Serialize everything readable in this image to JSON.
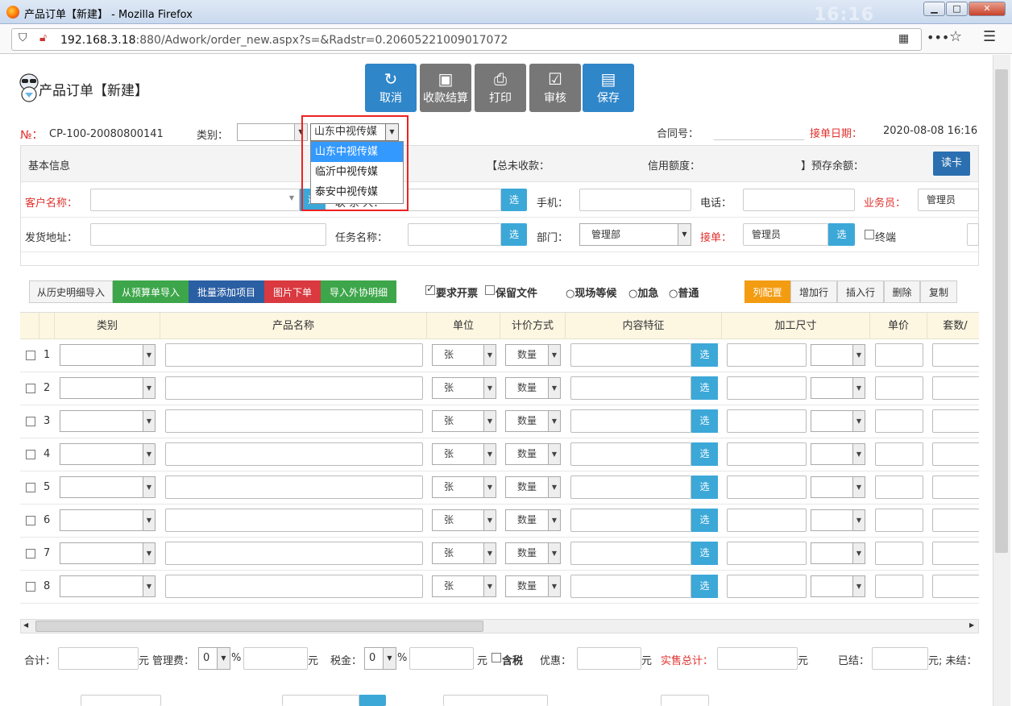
{
  "window": {
    "title": "产品订单【新建】 - Mozilla Firefox",
    "clock_ghost": "16:16"
  },
  "browser": {
    "url_host": "192.168.3.18",
    "url_rest": ":880/Adwork/order_new.aspx?s=&Radstr=0.20605221009017072",
    "url_icons": [
      "shield-icon",
      "insecure-lock-icon",
      "qr-icon",
      "more-icon",
      "star-icon",
      "menu-icon"
    ]
  },
  "page": {
    "title": "产品订单【新建】"
  },
  "toolbar": {
    "cancel": "取消",
    "collect": "收款结算",
    "print": "打印",
    "audit": "审核",
    "save": "保存"
  },
  "order": {
    "no_label": "№：",
    "no_value": "CP-100-20080800141",
    "category_label": "类别：",
    "company_value": "山东中视传媒",
    "contract_label": "合同号：",
    "date_label": "接单日期：",
    "date_value": "2020-08-08 16:16"
  },
  "dropdown": {
    "options": [
      "山东中视传媒",
      "临沂中视传媒",
      "泰安中视传媒"
    ],
    "selected_index": 0
  },
  "basic": {
    "title": "基本信息",
    "unpaid_label": "【总未收款：",
    "credit_label": "信用额度：",
    "prepay_label": "】预存余额：",
    "read_card": "读卡",
    "customer_label": "客户名称：",
    "xuan": "选",
    "contact_partial": "联 系 人：",
    "mobile_label": "手机：",
    "phone_label": "电话：",
    "salesman_label": "业务员：",
    "salesman_value": "管理员",
    "address_label": "发货地址：",
    "task_label": "任务名称：",
    "dept_label": "部门：",
    "dept_value": "管理部",
    "taker_label": "接单：",
    "taker_value": "管理员",
    "terminal_label": "终端"
  },
  "actions": {
    "from_history": "从历史明细导入",
    "from_budget": "从预算单导入",
    "batch_add": "批量添加项目",
    "image_order": "图片下单",
    "import_outsource": "导入外协明细",
    "need_invoice": "要求开票",
    "need_invoice_checked": true,
    "keep_file": "保留文件",
    "keep_file_checked": false,
    "wait_onsite": "现场等候",
    "urgent": "加急",
    "normal": "普通",
    "col_config": "列配置",
    "add_row": "增加行",
    "insert_row": "插入行",
    "delete": "删除",
    "copy": "复制"
  },
  "grid": {
    "headers": [
      "类别",
      "产品名称",
      "单位",
      "计价方式",
      "内容特征",
      "加工尺寸",
      "单价",
      "套数/"
    ],
    "rows": [
      {
        "n": "1",
        "unit": "张",
        "pricing": "数量"
      },
      {
        "n": "2",
        "unit": "张",
        "pricing": "数量"
      },
      {
        "n": "3",
        "unit": "张",
        "pricing": "数量"
      },
      {
        "n": "4",
        "unit": "张",
        "pricing": "数量"
      },
      {
        "n": "5",
        "unit": "张",
        "pricing": "数量"
      },
      {
        "n": "6",
        "unit": "张",
        "pricing": "数量"
      },
      {
        "n": "7",
        "unit": "张",
        "pricing": "数量"
      },
      {
        "n": "8",
        "unit": "张",
        "pricing": "数量"
      }
    ],
    "xuan": "选"
  },
  "footer": {
    "total_label": "合计：",
    "yuan": "元",
    "mgmt_label": "管理费：",
    "mgmt_value": "0",
    "pct": "%",
    "tax_label": "税金：",
    "tax_value": "0",
    "tax_included": "含税",
    "discount_label": "优惠：",
    "sale_total_label": "实售总计：",
    "paid_label": "已结：",
    "unpaid_tail": "元; 未结："
  },
  "colors": {
    "accent_blue": "#2f86c9",
    "green": "#3da64a",
    "red_btn": "#d9393f",
    "navy": "#2b5fa3",
    "orange": "#f39c12",
    "label_red": "#e0312d"
  }
}
